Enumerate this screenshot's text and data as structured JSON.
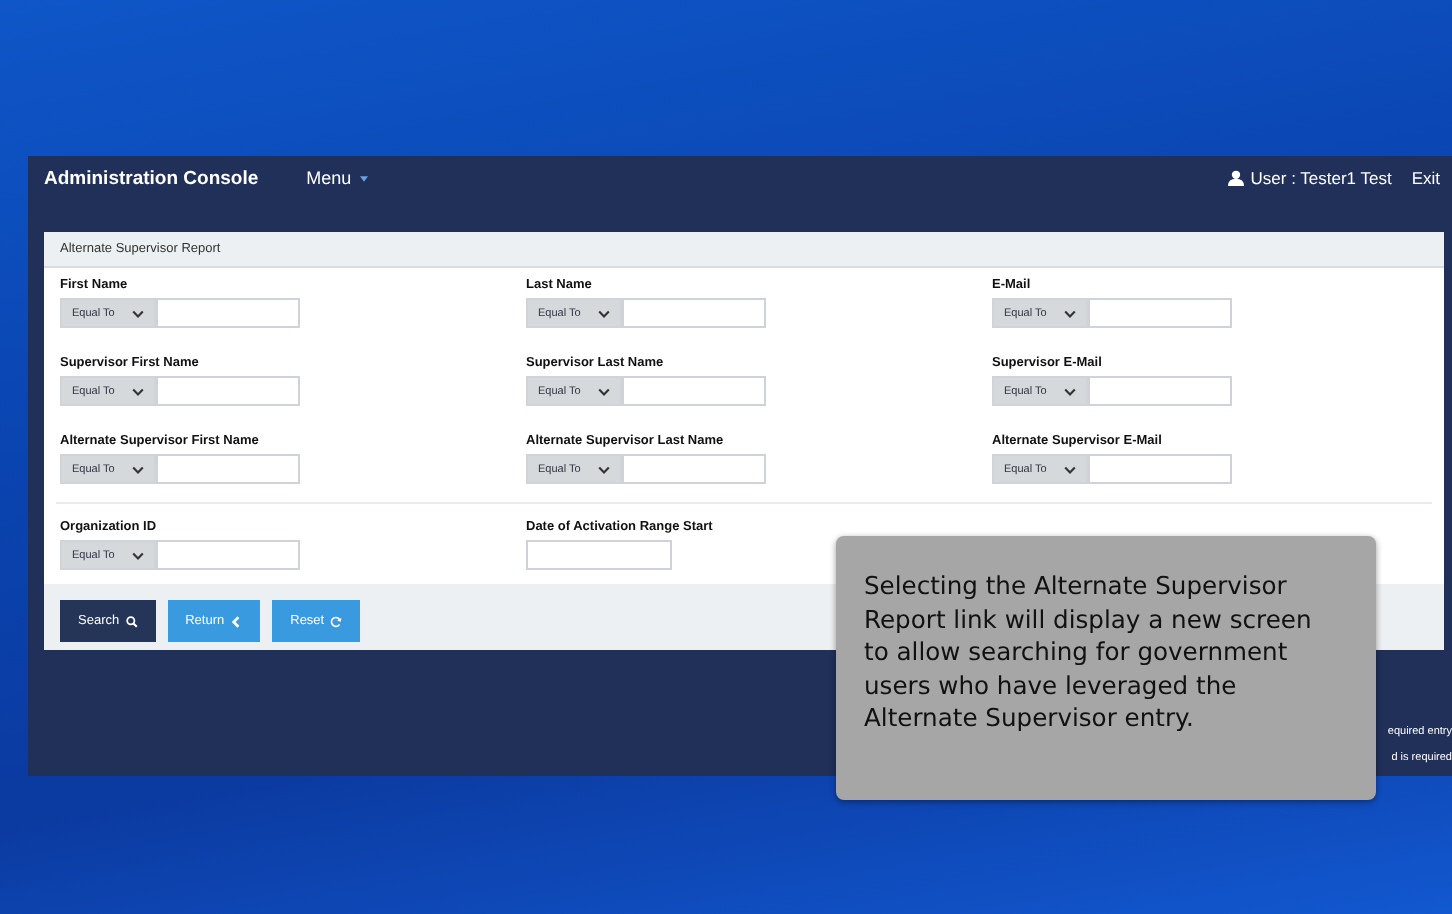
{
  "header": {
    "title": "Administration Console",
    "menu": "Menu",
    "user": "User : Tester1 Test",
    "exit": "Exit"
  },
  "panel": {
    "title": "Alternate Supervisor Report"
  },
  "field_rows": [
    {
      "fields": [
        {
          "label": "First Name",
          "kind": "operator",
          "operator": "Equal To"
        },
        {
          "label": "Last Name",
          "kind": "operator",
          "operator": "Equal To"
        },
        {
          "label": "E-Mail",
          "kind": "operator",
          "operator": "Equal To"
        }
      ]
    },
    {
      "fields": [
        {
          "label": "Supervisor First Name",
          "kind": "operator",
          "operator": "Equal To"
        },
        {
          "label": "Supervisor Last Name",
          "kind": "operator",
          "operator": "Equal To"
        },
        {
          "label": "Supervisor E-Mail",
          "kind": "operator",
          "operator": "Equal To"
        }
      ]
    },
    {
      "fields": [
        {
          "label": "Alternate Supervisor First Name",
          "kind": "operator",
          "operator": "Equal To"
        },
        {
          "label": "Alternate Supervisor Last Name",
          "kind": "operator",
          "operator": "Equal To"
        },
        {
          "label": "Alternate Supervisor E-Mail",
          "kind": "operator",
          "operator": "Equal To"
        }
      ]
    },
    {
      "fields": [
        {
          "label": "Organization ID",
          "kind": "operator",
          "operator": "Equal To"
        },
        {
          "label": "Date of Activation Range Start",
          "kind": "date"
        }
      ]
    }
  ],
  "buttons": [
    {
      "label": "Search",
      "kind": "search"
    },
    {
      "label": "Return",
      "kind": "return"
    },
    {
      "label": "Reset",
      "kind": "reset"
    }
  ],
  "notes": [
    "equired entry",
    "d is required"
  ],
  "callout": {
    "text": "Selecting the Alternate Supervisor Report link will display a new screen to allow searching for government users who have leveraged the Alternate Supervisor entry."
  }
}
